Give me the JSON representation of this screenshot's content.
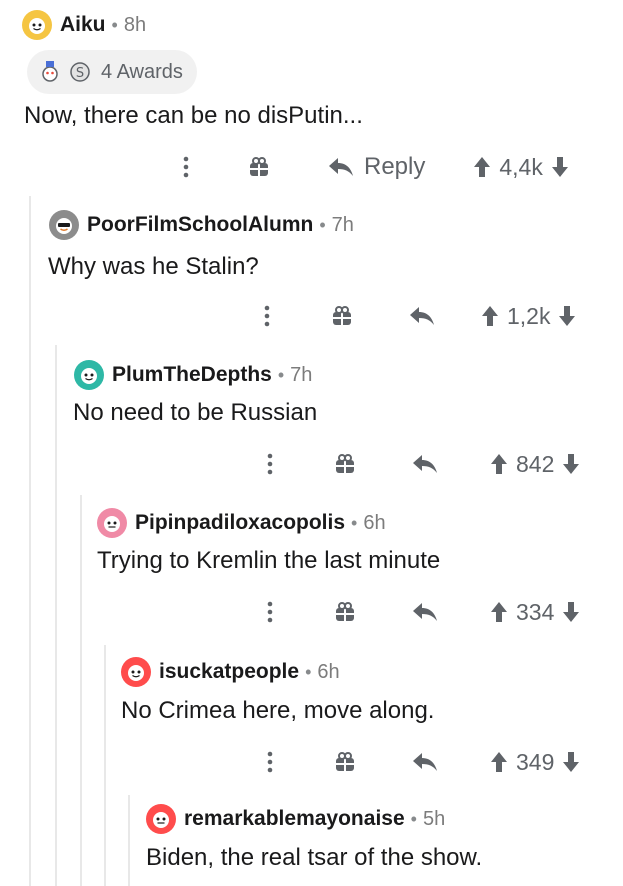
{
  "comments": [
    {
      "username": "Aiku",
      "age": "8h",
      "awards": "4 Awards",
      "body": "Now, there can be no disPutin...",
      "reply_label": "Reply",
      "score": "4,4k"
    },
    {
      "username": "PoorFilmSchoolAlumn",
      "age": "7h",
      "body": "Why was he Stalin?",
      "score": "1,2k"
    },
    {
      "username": "PlumTheDepths",
      "age": "7h",
      "body": "No need to be Russian",
      "score": "842"
    },
    {
      "username": "Pipinpadiloxacopolis",
      "age": "6h",
      "body": "Trying to Kremlin the last minute",
      "score": "334"
    },
    {
      "username": "isuckatpeople",
      "age": "6h",
      "body": "No Crimea here, move along.",
      "score": "349"
    },
    {
      "username": "remarkablemayonaise",
      "age": "5h",
      "body": "Biden, the real tsar of the show."
    }
  ],
  "colors": {
    "icon_gray": "#5f6368",
    "thread_line": "#e8e8e8",
    "avatar_yellow": "#f5c542",
    "avatar_teal": "#2eb8a6",
    "avatar_pink": "#f08aa6",
    "avatar_red": "#ff4c4c",
    "avatar_gray": "#8c8c8c"
  }
}
